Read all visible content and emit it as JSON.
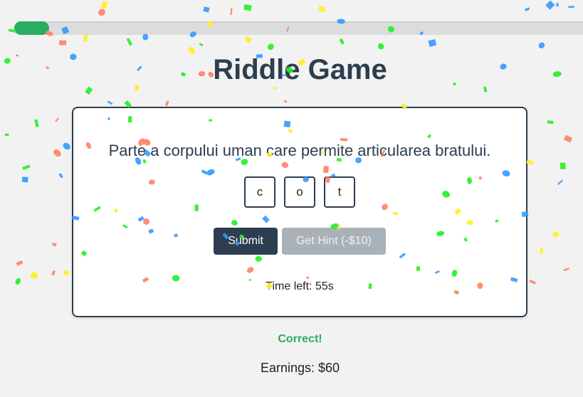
{
  "progress": {
    "percent": 6
  },
  "title": "Riddle Game",
  "riddle": {
    "question": "Parte a corpului uman care permite articularea bratului.",
    "letters": [
      "c",
      "o",
      "t"
    ]
  },
  "buttons": {
    "submit_label": "Submit",
    "hint_label": "Get Hint (-$10)"
  },
  "timer_text": "Time left: 55s",
  "feedback": "Correct!",
  "earnings_text": "Earnings: $60",
  "colors": {
    "accent": "#27ae60",
    "primary": "#2c3e50",
    "disabled": "#aab2b9",
    "confetti": [
      "#ff7f66",
      "#3399ff",
      "#22ee22",
      "#ffee22"
    ]
  }
}
